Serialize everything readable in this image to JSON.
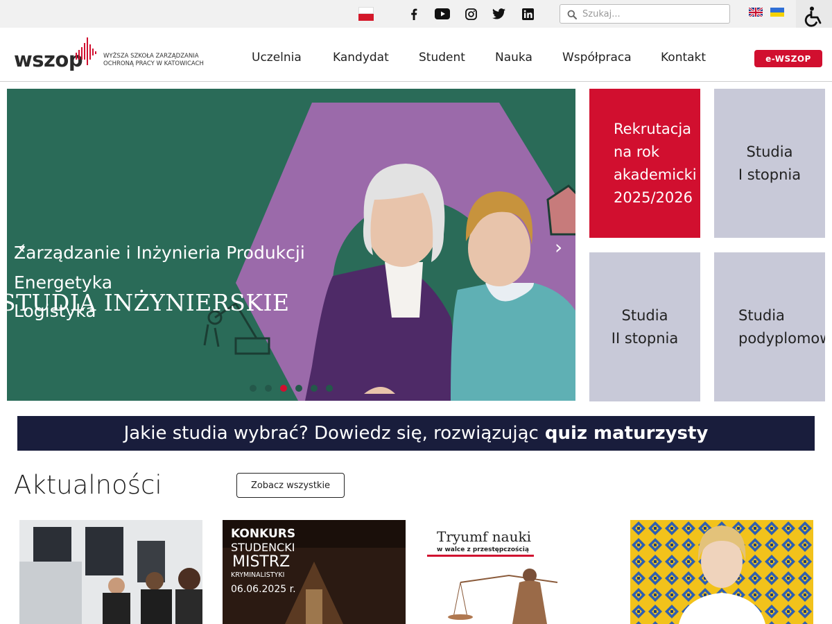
{
  "topbar": {
    "search_placeholder": "Szukaj...",
    "social_icons": [
      "facebook-icon",
      "youtube-icon",
      "instagram-icon",
      "twitter-icon",
      "linkedin-icon"
    ],
    "languages": [
      "English",
      "Українська"
    ]
  },
  "header": {
    "logo_word": "wszop",
    "logo_line1": "WYŻSZA SZKOŁA ZARZĄDZANIA",
    "logo_line2": "OCHRONĄ PRACY W KATOWICACH",
    "nav": [
      "Uczelnia",
      "Kandydat",
      "Student",
      "Nauka",
      "Współpraca",
      "Kontakt"
    ],
    "cta_label": "e-WSZOP"
  },
  "slider": {
    "title": "STUDIA INŻYNIERSKIE",
    "lines": [
      "Zarządzanie i Inżynieria Produkcji",
      "Energetyka",
      "Logistyka"
    ],
    "prev": "‹",
    "next": "›",
    "dot_count": 6,
    "active_dot": 3
  },
  "tiles": [
    "Rekrutacja\nna rok\nakademicki\n2025/2026",
    "Studia\nI stopnia",
    "Studia\nII stopnia",
    "Studia\npodyplomowe"
  ],
  "quiz": {
    "text": "Jakie studia wybrać? Dowiedz się, rozwiązując",
    "bold": "quiz maturzysty"
  },
  "news": {
    "heading": "Aktualności",
    "see_all": "Zobacz wszystkie",
    "cards": [
      {},
      {
        "badge": "KONKURS",
        "l1": "STUDENCKI",
        "l2": "MISTRZ",
        "l3": "KRYMINALISTYKI",
        "date": "06.06.2025 r."
      },
      {
        "headline": "Tryumf nauki",
        "sub": "w walce z przestępczością"
      },
      {}
    ]
  },
  "colors": {
    "brand_red": "#d10f2f",
    "hero_green": "#2a6b58",
    "hero_purple": "#9b6aaa",
    "tile_gray": "#c8c9d8",
    "quiz_navy": "#191d3c"
  }
}
